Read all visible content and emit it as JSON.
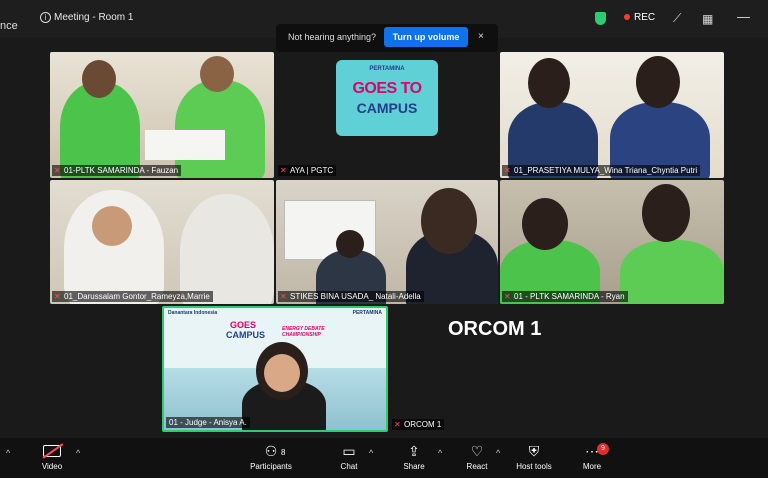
{
  "titlebar": {
    "left_cut": "nce",
    "title": "Meeting - Room 1",
    "rec_label": "REC",
    "icons": [
      "info-icon",
      "shield-icon",
      "magic-wand-icon",
      "grid-icon",
      "minimize-icon"
    ]
  },
  "notice": {
    "message": "Not hearing anything?",
    "button": "Turn up volume",
    "close": "×"
  },
  "logo": {
    "brand": "PERTAMINA",
    "line1": "GOES TO",
    "line2": "CAMPUS"
  },
  "participants": [
    {
      "name": "01-PLTK SAMARINDA - Fauzan"
    },
    {
      "name": "AYA | PGTC"
    },
    {
      "name": "01_PRASETIYA MULYA_Wina Triana_Chyntia Putri"
    },
    {
      "name": "01_Darussalam Gontor_Rameyza,Marrie"
    },
    {
      "name": "STIKES BINA USADA_ Natali-Adella"
    },
    {
      "name": "01 - PLTK SAMARINDA - Ryan"
    },
    {
      "name": "01 - Judge - Anisya A."
    },
    {
      "name": "ORCOM 1"
    }
  ],
  "judge_tile": {
    "logo_left": "Danantara Indonesia",
    "logo_right": "PERTAMINA",
    "title_top": "GOES",
    "title_bottom": "CAMPUS",
    "event": "ENERGY DEBATE CHAMPIONSHIP"
  },
  "orcom_big": "ORCOM 1",
  "toolbar": {
    "video": "Video",
    "participants": "Participants",
    "participants_count": "8",
    "chat": "Chat",
    "share": "Share",
    "react": "React",
    "host_tools": "Host tools",
    "more": "More",
    "more_badge": "9"
  },
  "colors": {
    "accent_blue": "#0e72ed",
    "rec_red": "#ff3b30",
    "shield_green": "#2ecc71",
    "uniform_green": "#4cc34a",
    "background": "#1a1a1a"
  }
}
